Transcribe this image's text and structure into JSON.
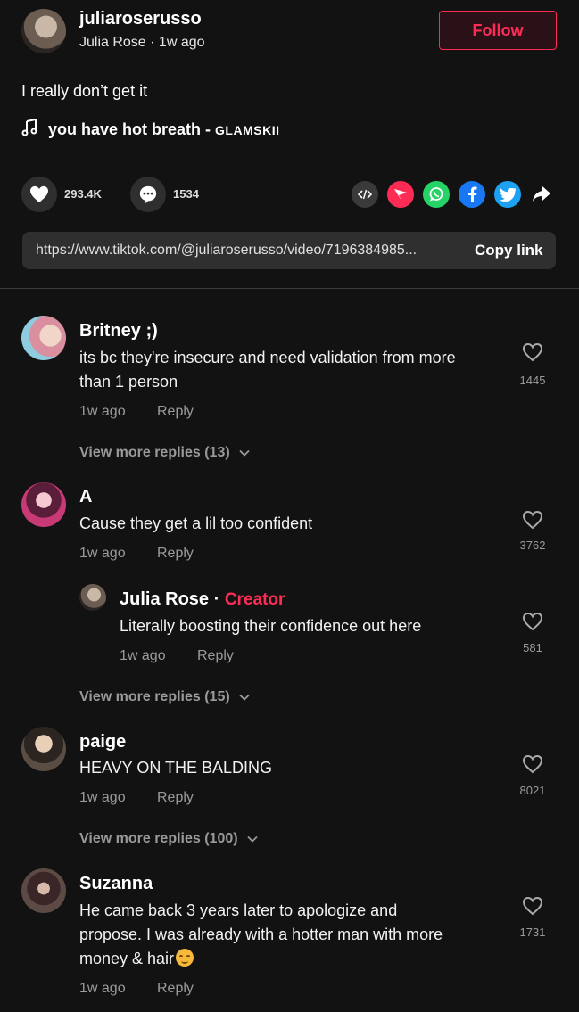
{
  "post": {
    "username": "juliaroserusso",
    "display_name": "Julia Rose",
    "time": "1w ago",
    "separator": " · ",
    "follow_label": "Follow",
    "caption": "I really don’t get it",
    "music_title": "you have hot breath - ",
    "music_artist": "GLAMSKII",
    "likes": "293.4K",
    "comments": "1534",
    "link": "https://www.tiktok.com/@juliaroserusso/video/7196384985...",
    "copy_label": "Copy link"
  },
  "comments": [
    {
      "name": "Britney ;)",
      "text_lines": [
        "its bc they're insecure and need validation from more",
        "than 1 person"
      ],
      "time": "1w ago",
      "reply": "Reply",
      "likes": "1445",
      "view_more": "View more replies (13)"
    },
    {
      "name": "A",
      "text_lines": [
        "Cause they get a lil too confident"
      ],
      "time": "1w ago",
      "reply": "Reply",
      "likes": "3762",
      "view_more": "View more replies (15)"
    },
    {
      "name": "paige",
      "text_lines": [
        "HEAVY ON THE BALDING"
      ],
      "time": "1w ago",
      "reply": "Reply",
      "likes": "8021",
      "view_more": "View more replies (100)"
    },
    {
      "name": "Suzanna",
      "text_lines": [
        "He came back 3 years later to apologize and",
        "propose. I was already with a hotter man with more",
        "money & hair"
      ],
      "time": "1w ago",
      "reply": "Reply",
      "likes": "1731"
    }
  ],
  "reply": {
    "name": "Julia Rose",
    "separator": " · ",
    "badge": "Creator",
    "text": "Literally boosting their confidence out here",
    "time": "1w ago",
    "reply": "Reply",
    "likes": "581"
  },
  "colors": {
    "accent": "#fe2c55",
    "background": "#121212",
    "whatsapp": "#25d366",
    "facebook": "#1877f2",
    "twitter": "#1da1f2"
  },
  "icons": {
    "like": "heart-icon",
    "comment": "speech-bubble-icon",
    "embed": "code-icon",
    "send": "send-icon",
    "share": "share-arrow-icon",
    "music": "music-note-icon",
    "chevron": "chevron-down-icon",
    "emoji": "relieved-face-emoji"
  }
}
